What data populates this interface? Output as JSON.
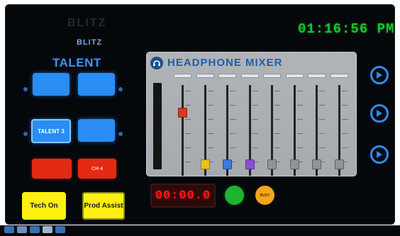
{
  "brand": {
    "faint_text": "BLITZ",
    "name": "BLITZ"
  },
  "clock": {
    "time": "01:16:56 PM"
  },
  "talent": {
    "section_label": "TALENT",
    "buttons": [
      {
        "label": "",
        "color": "#2a8df4"
      },
      {
        "label": "",
        "color": "#2a8df4"
      },
      {
        "label": "TALENT 3",
        "color": "#2a8df4"
      },
      {
        "label": "",
        "color": "#2a8df4"
      }
    ],
    "red_buttons": [
      {
        "label": "",
        "color": "#e42a13"
      },
      {
        "label": "CH 4",
        "color": "#e42a13"
      }
    ]
  },
  "actions": {
    "tech_on_label": "Tech On",
    "prod_assist_label": "Prod Assist"
  },
  "mixer": {
    "icon": "headphone-icon",
    "title": "HEADPHONE MIXER",
    "channels": [
      {
        "knob_color": "#d63a1d",
        "level": 0.72
      },
      {
        "knob_color": "#e6c21e",
        "level": 0.08
      },
      {
        "knob_color": "#3a7be0",
        "level": 0.08
      },
      {
        "knob_color": "#8a4fd6",
        "level": 0.08
      },
      {
        "knob_color": "#8f949a",
        "level": 0.08
      },
      {
        "knob_color": "#8f949a",
        "level": 0.08
      },
      {
        "knob_color": "#8f949a",
        "level": 0.08
      },
      {
        "knob_color": "#8f949a",
        "level": 0.08
      }
    ]
  },
  "transport": {
    "counter": "00:00.0",
    "green_button_label": "",
    "orange_button_label": "BUSY"
  },
  "play_buttons": [
    {
      "icon": "play-icon"
    },
    {
      "icon": "play-icon"
    },
    {
      "icon": "play-icon"
    }
  ],
  "colors": {
    "accent_blue": "#2a8df4",
    "clock_green": "#18c42a",
    "alert_red": "#e42a13",
    "yellow": "#ffef12",
    "green_button": "#1fb332",
    "orange_button": "#f7a516"
  }
}
